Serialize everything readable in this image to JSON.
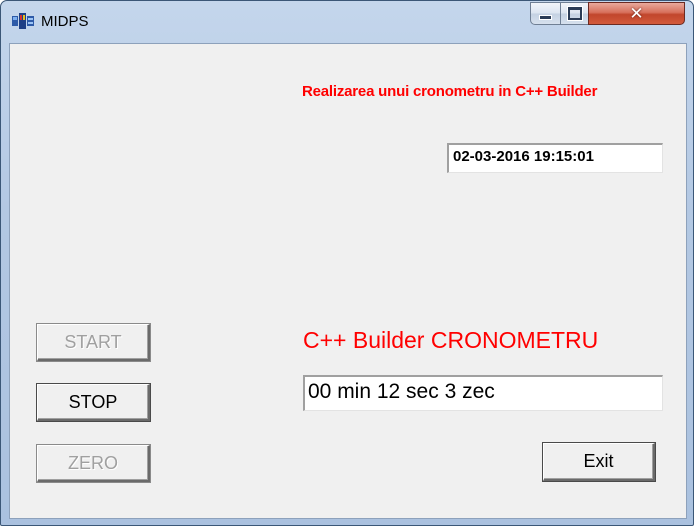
{
  "window": {
    "title": "MIDPS",
    "controls": {
      "minimize_icon": "minimize-icon",
      "maximize_icon": "maximize-icon",
      "close_icon": "close-icon",
      "close_glyph": "✕"
    }
  },
  "form": {
    "subtitle": "Realizarea unui cronometru in C++ Builder",
    "datetime": "02-03-2016 19:15:01",
    "cron_title": "C++ Builder CRONOMETRU",
    "cron_display": "00 min 12 sec 3 zec"
  },
  "buttons": {
    "start": {
      "label": "START",
      "enabled": false
    },
    "stop": {
      "label": "STOP",
      "enabled": true
    },
    "zero": {
      "label": "ZERO",
      "enabled": false
    },
    "exit": {
      "label": "Exit",
      "enabled": true
    }
  },
  "colors": {
    "accent_text": "#ff0000",
    "client_background": "#f0f0f0",
    "disabled_text": "#a0a0a0"
  }
}
